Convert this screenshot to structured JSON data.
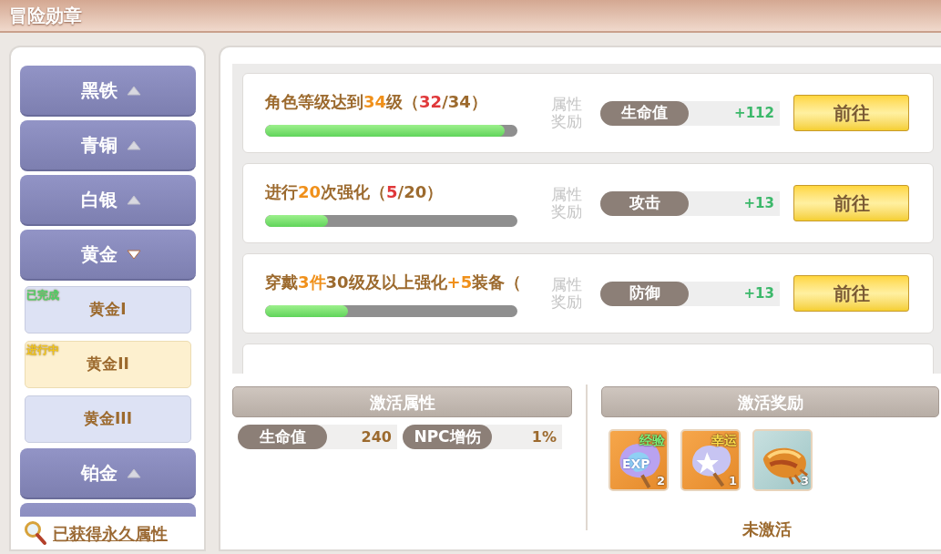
{
  "window": {
    "title": "冒险勋章"
  },
  "sidebar": {
    "items": [
      {
        "kind": "group",
        "label": "黑铁",
        "expanded": false
      },
      {
        "kind": "group",
        "label": "青铜",
        "expanded": false
      },
      {
        "kind": "group",
        "label": "白银",
        "expanded": false
      },
      {
        "kind": "group",
        "label": "黄金",
        "expanded": true,
        "children": [
          {
            "label": "黄金I",
            "selected": false,
            "badge": {
              "text": "已完成",
              "kind": "done"
            }
          },
          {
            "label": "黄金II",
            "selected": true,
            "badge": {
              "text": "进行中",
              "kind": "progress"
            }
          },
          {
            "label": "黄金III",
            "selected": false
          }
        ]
      },
      {
        "kind": "group",
        "label": "铂金",
        "expanded": false
      },
      {
        "kind": "cut"
      }
    ],
    "link": "已获得永久属性"
  },
  "tasks": [
    {
      "kind": "task",
      "title": [
        {
          "text": "角色等级达到",
          "kind": "plain"
        },
        {
          "text": "34",
          "kind": "target"
        },
        {
          "text": "级（",
          "kind": "plain"
        },
        {
          "text": "32",
          "kind": "current"
        },
        {
          "text": "/34）",
          "kind": "plain"
        }
      ],
      "level": 0.95,
      "reward_label": "属性奖励",
      "attribute": "生命值",
      "value": "+112",
      "button": "前往"
    },
    {
      "kind": "task",
      "title": [
        {
          "text": "进行",
          "kind": "plain"
        },
        {
          "text": "20",
          "kind": "target"
        },
        {
          "text": "次强化（",
          "kind": "plain"
        },
        {
          "text": "5",
          "kind": "current"
        },
        {
          "text": "/20）",
          "kind": "plain"
        }
      ],
      "level": 0.25,
      "reward_label": "属性奖励",
      "attribute": "攻击",
      "value": "+13",
      "button": "前往"
    },
    {
      "kind": "task",
      "title": [
        {
          "text": "穿戴",
          "kind": "plain"
        },
        {
          "text": "3件",
          "kind": "target"
        },
        {
          "text": "30级及以上强化",
          "kind": "plain"
        },
        {
          "text": "+5",
          "kind": "target"
        },
        {
          "text": "装备（",
          "kind": "plain"
        }
      ],
      "level": 0.33,
      "reward_label": "属性奖励",
      "attribute": "防御",
      "value": "+13",
      "button": "前往"
    },
    {
      "kind": "cut"
    }
  ],
  "activation": {
    "attributes": {
      "header": "激活属性",
      "stats": [
        {
          "name": "生命值",
          "value": "240"
        },
        {
          "name": "NPC增伤",
          "value": "1%"
        }
      ]
    },
    "rewards": {
      "header": "激活奖励",
      "items": [
        {
          "kind": "exp",
          "tag": "经验",
          "label": "EXP",
          "count": "2"
        },
        {
          "kind": "luck",
          "tag": "幸运",
          "count": "1"
        },
        {
          "kind": "bread",
          "count": "3"
        }
      ],
      "status": "未激活"
    }
  }
}
